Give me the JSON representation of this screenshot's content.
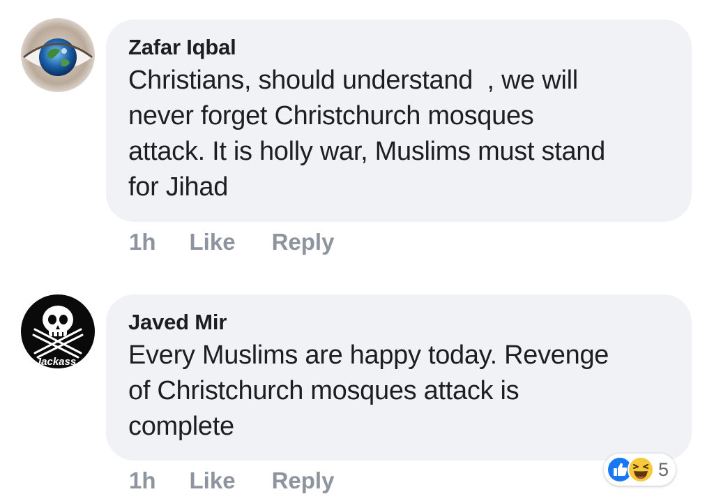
{
  "comments": [
    {
      "author": "Zafar Iqbal",
      "text": "Christians, should understand  , we will\nnever forget Christchurch mosques\nattack. It is holly war, Muslims must stand\nfor Jihad",
      "time": "1h",
      "like_label": "Like",
      "reply_label": "Reply",
      "avatar_icon": "eye-earth-avatar"
    },
    {
      "author": "Javed Mir",
      "text": "Every Muslims are happy today. Revenge\nof Christchurch mosques attack is\ncomplete",
      "time": "1h",
      "like_label": "Like",
      "reply_label": "Reply",
      "avatar_icon": "jackass-skull-avatar",
      "avatar_text": "Jackass",
      "reactions": {
        "icons": [
          "like-reaction-icon",
          "haha-reaction-icon"
        ],
        "count": "5"
      }
    }
  ],
  "colors": {
    "bubble": "#f0f2f5",
    "meta_text": "#8d949e",
    "like_blue": "#1877f2",
    "haha_yellow": "#f7c93b"
  }
}
